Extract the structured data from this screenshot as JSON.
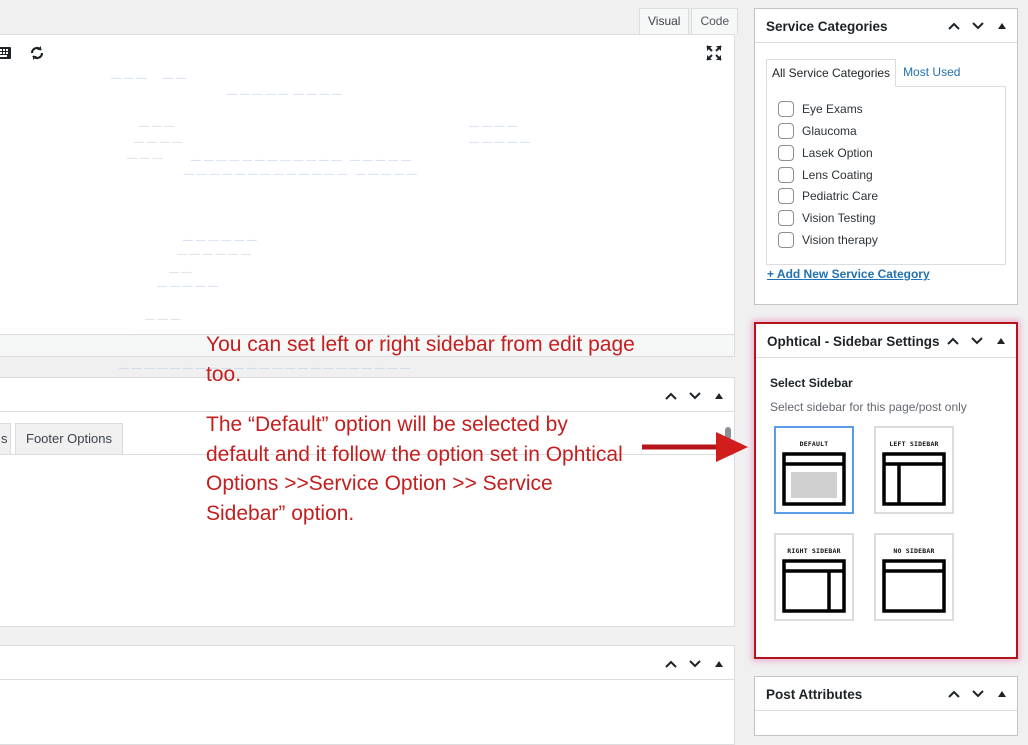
{
  "editor": {
    "tabs": [
      "Visual",
      "Code"
    ]
  },
  "metabox2": {
    "tabs": [
      "s",
      "Footer Options"
    ]
  },
  "annotation": {
    "p1": "You can set left or right sidebar from edit page too.",
    "p2": "The “Default” option will be selected by default and it follow the option set in Ophtical Options >>Service Option >> Service Sidebar” option."
  },
  "service_categories": {
    "title": "Service Categories",
    "tab_all": "All Service Categories",
    "tab_most_used": "Most Used",
    "items": [
      "Eye Exams",
      "Glaucoma",
      "Lasek Option",
      "Lens Coating",
      "Pediatric Care",
      "Vision Testing",
      "Vision therapy"
    ],
    "add_new": "+ Add New Service Category"
  },
  "sidebar_settings": {
    "title": "Ophtical - Sidebar Settings",
    "label": "Select Sidebar",
    "description": "Select sidebar for this page/post only",
    "options": [
      {
        "label": "DEFAULT",
        "selected": true
      },
      {
        "label": "LEFT SIDEBAR",
        "selected": false
      },
      {
        "label": "RIGHT SIDEBAR",
        "selected": false
      },
      {
        "label": "NO SIDEBAR",
        "selected": false
      }
    ]
  },
  "post_attributes": {
    "title": "Post Attributes"
  },
  "colors": {
    "annotation": "#c41e1e",
    "highlight_border": "#b5151a",
    "link": "#2271b1",
    "selected_layout": "#5b9be8"
  }
}
